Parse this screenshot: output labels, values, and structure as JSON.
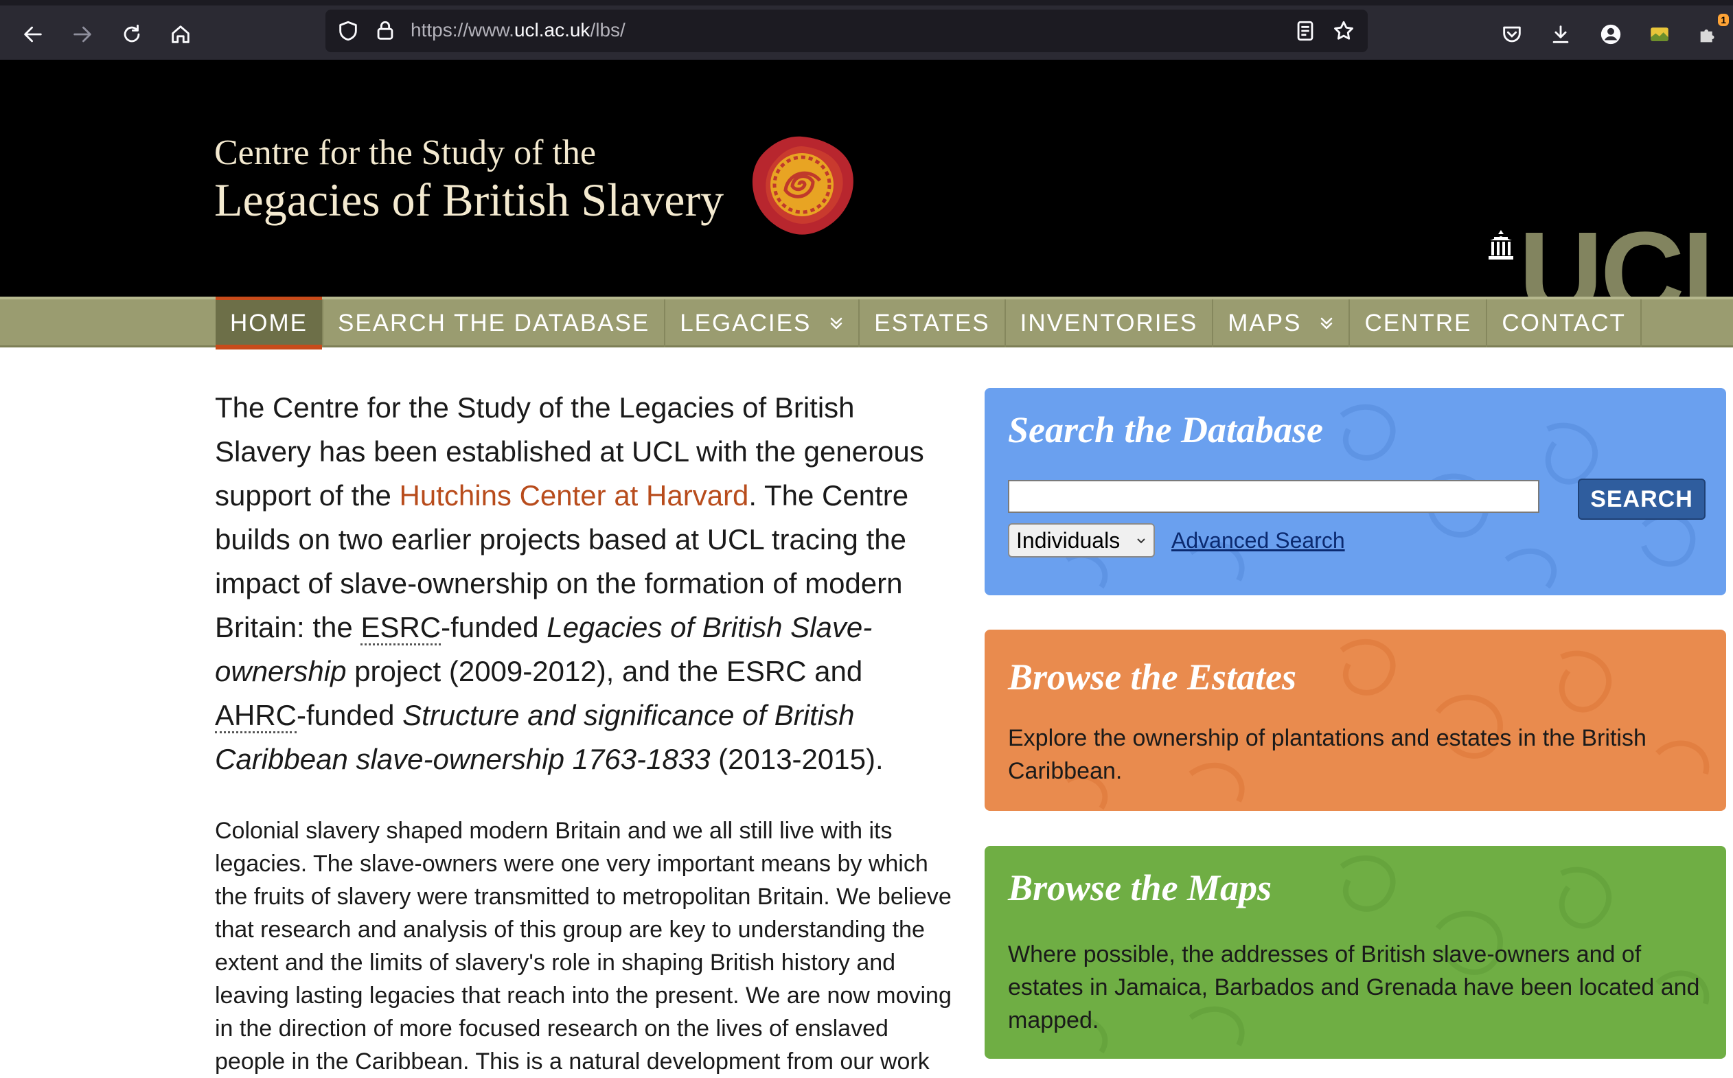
{
  "browser": {
    "url_prefix": "https://www.",
    "url_domain": "ucl.ac.uk",
    "url_path": "/lbs/",
    "extension_badge": "1"
  },
  "header": {
    "title_line1": "Centre for the Study of the",
    "title_line2": "Legacies of British Slavery",
    "ucl_logo": "UCL"
  },
  "nav": {
    "items": [
      {
        "label": "HOME"
      },
      {
        "label": "SEARCH THE DATABASE"
      },
      {
        "label": "LEGACIES"
      },
      {
        "label": "ESTATES"
      },
      {
        "label": "INVENTORIES"
      },
      {
        "label": "MAPS"
      },
      {
        "label": "CENTRE"
      },
      {
        "label": "CONTACT"
      }
    ]
  },
  "intro": {
    "part1": "The Centre for the Study of the Legacies of British Slavery has been established at UCL with the generous support of the ",
    "link": "Hutchins Center at Harvard",
    "part2": ". The Centre builds on two earlier projects based at UCL tracing the impact of slave-ownership on the formation of modern Britain: the ",
    "abbr_esrc": "ESRC",
    "part3": "-funded ",
    "italic1": "Legacies of British Slave-ownership",
    "part4": " project (2009-2012), and the ESRC and ",
    "abbr_ahrc": "AHRC",
    "part5": "-funded ",
    "italic2": "Structure and significance of British Caribbean slave-ownership 1763-1833",
    "part6": " (2013-2015)."
  },
  "body": {
    "paragraph": "Colonial slavery shaped modern Britain and we all still live with its legacies. The slave-owners were one very important means by which the fruits of slavery were transmitted to metropolitan Britain. We believe that research and analysis of this group are key to understanding the extent and the limits of slavery's role in shaping British history and leaving lasting legacies that reach into the present. We are now moving in the direction of more focused research on the lives of enslaved people in the Caribbean. This is a natural development from our work"
  },
  "search_panel": {
    "title": "Search the Database",
    "input_value": "",
    "button_label": "SEARCH",
    "select_value": "Individuals",
    "advanced_link": "Advanced Search"
  },
  "estates_panel": {
    "title": "Browse the Estates",
    "text": "Explore the ownership of plantations and estates in the British Caribbean."
  },
  "maps_panel": {
    "title": "Browse the Maps",
    "text": "Where possible, the addresses of British slave-owners and of estates in Jamaica, Barbados and Grenada have been located and mapped."
  },
  "colors": {
    "search_panel": "#6aa0ef",
    "estates_panel": "#e98b4e",
    "maps_panel": "#6fae44",
    "nav_background": "#9a9c70",
    "nav_active_accent": "#c84b1a",
    "link": "#b84c1c"
  }
}
